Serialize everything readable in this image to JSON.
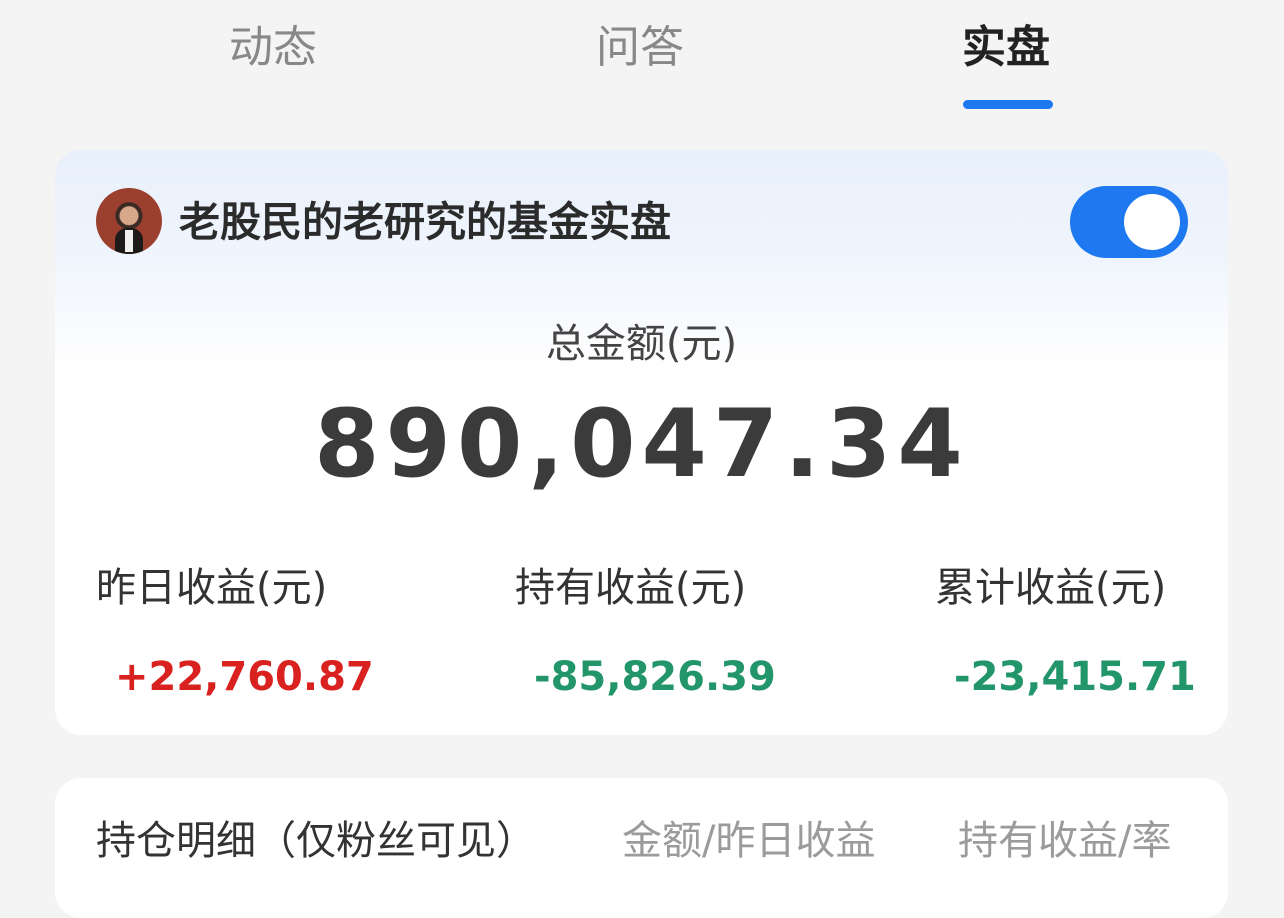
{
  "tabs": [
    {
      "label": "动态"
    },
    {
      "label": "问答"
    },
    {
      "label": "实盘",
      "active": true
    }
  ],
  "colors": {
    "accent": "#1e78f0",
    "gain": "#d9221f",
    "loss": "#23956a"
  },
  "portfolio": {
    "title": "老股民的老研究的基金实盘",
    "avatar_icon": "user-avatar",
    "toggle_on": true
  },
  "summary": {
    "total_label": "总金额(元)",
    "total_value": "890,047.34",
    "stats": [
      {
        "label": "昨日收益(元)",
        "value": "+22,760.87"
      },
      {
        "label": "持有收益(元)",
        "value": "-85,826.39"
      },
      {
        "label": "累计收益(元)",
        "value": "-23,415.71"
      }
    ]
  },
  "holdings": {
    "title": "持仓明细（仅粉丝可见）",
    "columns": [
      "金额/昨日收益",
      "持有收益/率"
    ]
  }
}
